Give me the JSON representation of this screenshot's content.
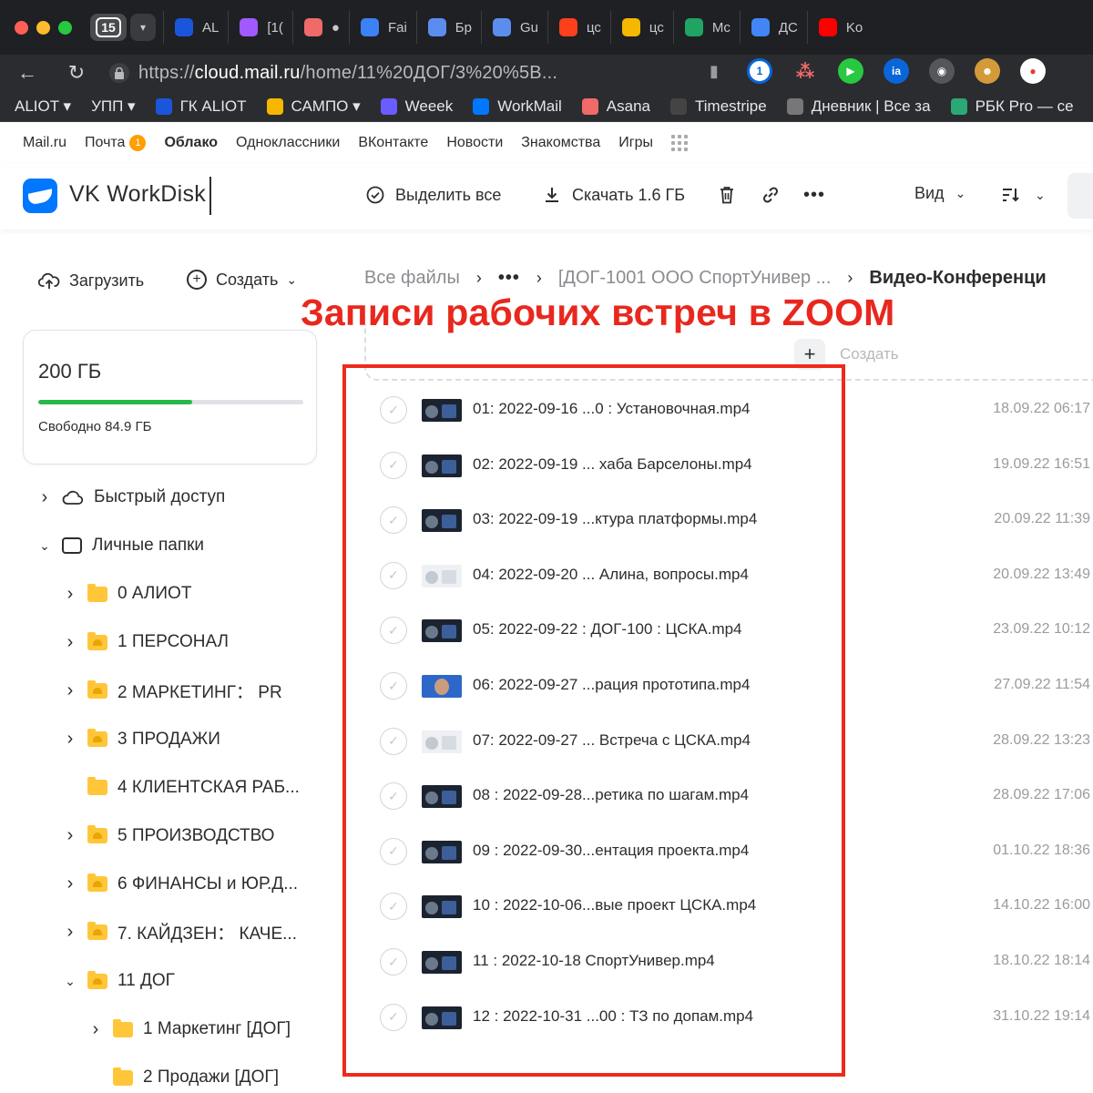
{
  "browser": {
    "tab_count": "15",
    "tabs": [
      {
        "label": "AL",
        "icon": "aliot-favicon",
        "color": "#1a56db"
      },
      {
        "label": "[1(",
        "icon": "figma-favicon",
        "color": "#a259ff"
      },
      {
        "label": "",
        "icon": "asana-favicon",
        "color": "#f06a6a"
      },
      {
        "label": "Fai",
        "icon": "wing-favicon",
        "color": "#3b82f6"
      },
      {
        "label": "Бр",
        "icon": "cube-favicon",
        "color": "#5b8def"
      },
      {
        "label": "Gu",
        "icon": "cube-favicon",
        "color": "#5b8def"
      },
      {
        "label": "цс",
        "icon": "yandex-favicon",
        "color": "#fc3f1d"
      },
      {
        "label": "цс",
        "icon": "image-favicon",
        "color": "#f5b700"
      },
      {
        "label": "Mc",
        "icon": "drive-favicon",
        "color": "#1fa463"
      },
      {
        "label": "ДС",
        "icon": "docs-favicon",
        "color": "#4285f4"
      },
      {
        "label": "Ko",
        "icon": "youtube-favicon",
        "color": "#ff0000"
      }
    ],
    "url_prefix": "https://",
    "url_host": "cloud.mail.ru",
    "url_path": "/home/11%20ДОГ/3%20%5B...",
    "bookmarks": [
      {
        "label": "ALIOT ▾",
        "icon": "",
        "color": ""
      },
      {
        "label": "УПП ▾",
        "icon": "",
        "color": ""
      },
      {
        "label": "ГК ALIOT",
        "icon": "aliot-bookmark-icon",
        "color": "#1a56db"
      },
      {
        "label": "САМПО ▾",
        "icon": "emoji-bookmark-icon",
        "color": "#f5b700"
      },
      {
        "label": "Weeek",
        "icon": "weeek-bookmark-icon",
        "color": "#6b5cff"
      },
      {
        "label": "WorkMail",
        "icon": "workmail-bookmark-icon",
        "color": "#0077ff"
      },
      {
        "label": "Asana",
        "icon": "asana-bookmark-icon",
        "color": "#f06a6a"
      },
      {
        "label": "Timestripe",
        "icon": "timestripe-bookmark-icon",
        "color": "#444444"
      },
      {
        "label": "Дневник | Все за",
        "icon": "diary-bookmark-icon",
        "color": "#777777"
      },
      {
        "label": "РБК Pro — се",
        "icon": "rbk-bookmark-icon",
        "color": "#2aa876"
      }
    ]
  },
  "portal": {
    "links": [
      {
        "label": "Mail.ru",
        "active": false,
        "badge": ""
      },
      {
        "label": "Почта",
        "active": false,
        "badge": "1"
      },
      {
        "label": "Облако",
        "active": true,
        "badge": ""
      },
      {
        "label": "Одноклассники",
        "active": false,
        "badge": ""
      },
      {
        "label": "ВКонтакте",
        "active": false,
        "badge": ""
      },
      {
        "label": "Новости",
        "active": false,
        "badge": ""
      },
      {
        "label": "Знакомства",
        "active": false,
        "badge": ""
      },
      {
        "label": "Игры",
        "active": false,
        "badge": ""
      }
    ]
  },
  "header": {
    "product": "VK WorkDisk",
    "select_all": "Выделить все",
    "download": "Скачать 1.6 ГБ",
    "view": "Вид"
  },
  "sidebar": {
    "upload": "Загрузить",
    "create": "Создать",
    "storage_total": "200 ГБ",
    "storage_free": "Свободно 84.9 ГБ",
    "storage_used_fraction": 0.58,
    "tree": [
      {
        "label": "Быстрый доступ",
        "level": 0,
        "chevron": "right",
        "icon": "cloud"
      },
      {
        "label": "Личные папки",
        "level": 0,
        "chevron": "down",
        "icon": "outline-folder"
      },
      {
        "label": "0 АЛИОТ",
        "level": 1,
        "chevron": "right",
        "icon": "folder"
      },
      {
        "label": "1 ПЕРСОНАЛ",
        "level": 1,
        "chevron": "right",
        "icon": "shared-folder"
      },
      {
        "label": "2 МАРКЕТИНГ： PR",
        "level": 1,
        "chevron": "right",
        "icon": "shared-folder"
      },
      {
        "label": "3 ПРОДАЖИ",
        "level": 1,
        "chevron": "right",
        "icon": "shared-folder"
      },
      {
        "label": "4 КЛИЕНТСКАЯ РАБ...",
        "level": 1,
        "chevron": "",
        "icon": "folder"
      },
      {
        "label": "5 ПРОИЗВОДСТВО",
        "level": 1,
        "chevron": "right",
        "icon": "shared-folder"
      },
      {
        "label": "6 ФИНАНСЫ и ЮР.Д...",
        "level": 1,
        "chevron": "right",
        "icon": "shared-folder"
      },
      {
        "label": "7. КАЙДЗЕН： КАЧЕ...",
        "level": 1,
        "chevron": "right",
        "icon": "shared-folder"
      },
      {
        "label": "11 ДОГ",
        "level": 1,
        "chevron": "down",
        "icon": "shared-folder"
      },
      {
        "label": "1 Маркетинг [ДОГ]",
        "level": 2,
        "chevron": "right",
        "icon": "folder"
      },
      {
        "label": "2 Продажи [ДОГ]",
        "level": 2,
        "chevron": "",
        "icon": "folder"
      }
    ]
  },
  "breadcrumbs": {
    "root": "Все файлы",
    "ellipsis": "•••",
    "parent": "[ДОГ-1001 ООО СпортУнивер ...",
    "current": "Видео-Конференци"
  },
  "dropzone": {
    "create_label": "Создать"
  },
  "annotation": "Записи рабочих встреч в ZOOM",
  "files": [
    {
      "name": "01:   2022-09-16 ...0 :   Установочная.mp4",
      "date": "18.09.22 06:17",
      "thumb": "dark"
    },
    {
      "name": "02:   2022-09-19 ... хаба Барселоны.mp4",
      "date": "19.09.22 16:51",
      "thumb": "dark"
    },
    {
      "name": "03:   2022-09-19 ...ктура платформы.mp4",
      "date": "20.09.22 11:39",
      "thumb": "dark"
    },
    {
      "name": "04:   2022-09-20 ... Алина, вопросы.mp4",
      "date": "20.09.22 13:49",
      "thumb": "light"
    },
    {
      "name": "05:   2022-09-22 :   ДОГ-100 :   ЦСКА.mp4",
      "date": "23.09.22 10:12",
      "thumb": "dark"
    },
    {
      "name": "06:   2022-09-27 ...рация прототипа.mp4",
      "date": "27.09.22 11:54",
      "thumb": "blue"
    },
    {
      "name": "07:   2022-09-27 ... Встреча с ЦСКА.mp4",
      "date": "28.09.22 13:23",
      "thumb": "light"
    },
    {
      "name": "08 :   2022-09-28...ретика по шагам.mp4",
      "date": "28.09.22 17:06",
      "thumb": "dark"
    },
    {
      "name": "09 :   2022-09-30...ентация проекта.mp4",
      "date": "01.10.22 18:36",
      "thumb": "dark"
    },
    {
      "name": "10 :   2022-10-06...вые проект ЦСКА.mp4",
      "date": "14.10.22 16:00",
      "thumb": "dark"
    },
    {
      "name": "11 :   2022-10-18 СпортУнивер.mp4",
      "date": "18.10.22 18:14",
      "thumb": "dark"
    },
    {
      "name": "12 :   2022-10-31 ...00 :   ТЗ по допам.mp4",
      "date": "31.10.22 19:14",
      "thumb": "dark"
    }
  ]
}
